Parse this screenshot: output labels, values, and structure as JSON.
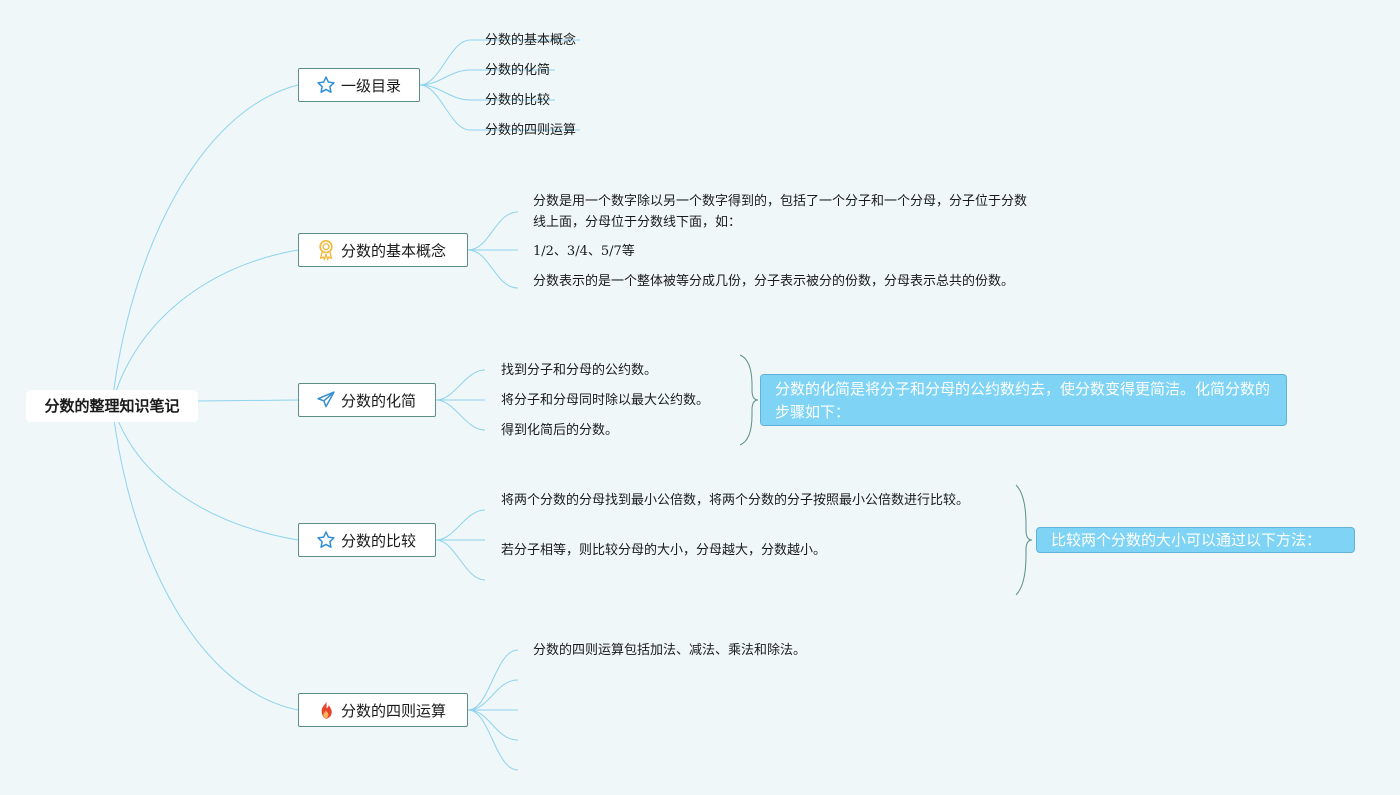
{
  "root": {
    "title": "分数的整理知识笔记"
  },
  "branches": [
    {
      "label": "一级目录",
      "icon": "star-icon",
      "children": [
        "分数的基本概念",
        "分数的化简",
        "分数的比较",
        "分数的四则运算"
      ]
    },
    {
      "label": "分数的基本概念",
      "icon": "medal-icon",
      "children": [
        "分数是用一个数字除以另一个数字得到的，包括了一个分子和一个分母，分子位于分数线上面，分母位于分数线下面，如：",
        "1/2、3/4、5/7等",
        "分数表示的是一个整体被等分成几份，分子表示被分的份数，分母表示总共的份数。"
      ]
    },
    {
      "label": "分数的化简",
      "icon": "paper-plane-icon",
      "children": [
        "找到分子和分母的公约数。",
        "将分子和分母同时除以最大公约数。",
        "得到化简后的分数。"
      ],
      "summary": "分数的化简是将分子和分母的公约数约去，使分数变得更简洁。化简分数的步骤如下："
    },
    {
      "label": "分数的比较",
      "icon": "star-icon",
      "children": [
        "将两个分数的分母找到最小公倍数，将两个分数的分子按照最小公倍数进行比较。",
        "若分子相等，则比较分母的大小，分母越大，分数越小。",
        ""
      ],
      "summary": "比较两个分数的大小可以通过以下方法："
    },
    {
      "label": "分数的四则运算",
      "icon": "fire-icon",
      "children": [
        "分数的四则运算包括加法、减法、乘法和除法。",
        "",
        "",
        "",
        ""
      ]
    }
  ],
  "colors": {
    "background": "#eff7f9",
    "line": "#8fd3ee",
    "node_border": "#5b8f86",
    "callout_fill": "#7fd4f6",
    "star": "#2f8fd8",
    "medal": "#f2b93b",
    "plane": "#3a8fd0",
    "fire": "#e8432a"
  }
}
